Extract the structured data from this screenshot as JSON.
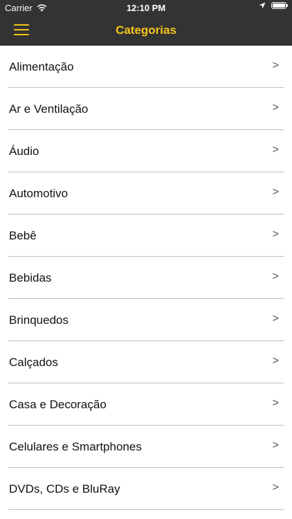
{
  "status_bar": {
    "carrier": "Carrier",
    "time": "12:10 PM",
    "battery_level": 1.0
  },
  "nav": {
    "title": "Categorias",
    "menu_icon": "hamburger-menu-icon",
    "accent_color": "#f5c518",
    "bar_color": "#333333"
  },
  "categories": [
    {
      "label": "Alimentação",
      "chevron": ">"
    },
    {
      "label": "Ar e Ventilação",
      "chevron": ">"
    },
    {
      "label": "Áudio",
      "chevron": ">"
    },
    {
      "label": "Automotivo",
      "chevron": ">"
    },
    {
      "label": "Bebê",
      "chevron": ">"
    },
    {
      "label": "Bebidas",
      "chevron": ">"
    },
    {
      "label": "Brinquedos",
      "chevron": ">"
    },
    {
      "label": "Calçados",
      "chevron": ">"
    },
    {
      "label": "Casa e Decoração",
      "chevron": ">"
    },
    {
      "label": "Celulares e Smartphones",
      "chevron": ">"
    },
    {
      "label": "DVDs, CDs e BluRay",
      "chevron": ">"
    }
  ]
}
